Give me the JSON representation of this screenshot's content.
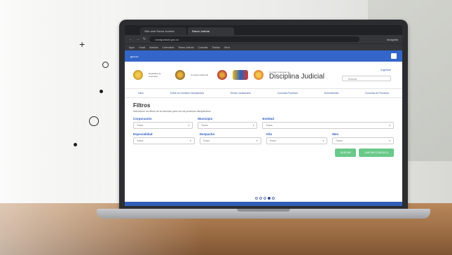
{
  "browser": {
    "tabs": [
      {
        "label": "Sitio web Rama Judicial"
      },
      {
        "label": "Rama Judicial"
      }
    ],
    "address": "ramajudicial.gov.co",
    "incognito": "Incógnito",
    "bookmarks": [
      "Apps",
      "Gmail",
      "Noticias",
      "Calendario",
      "Rama Judicial",
      "Consulta",
      "Tutelas",
      "Otros"
    ]
  },
  "site": {
    "gov_logo": "gov.co",
    "logo_texts": [
      "República de Colombia",
      "Comisión Nacional",
      "Rama Judicial"
    ],
    "brand_title": "Disciplina Judicial",
    "brand_small": "Comisión Nacional de",
    "login": "Ingresar",
    "search_placeholder": "Buscar"
  },
  "nav": [
    "Inicio",
    "Sobre la Comisión Disciplinaria",
    "Temas Jurisdicción",
    "Consulta Procesos",
    "Normatividad",
    "Consulta de Procesos"
  ],
  "filters": {
    "title": "Filtros",
    "description": "Seleccione los filtros de su elección para ver los procesos disciplinarios",
    "row1": [
      {
        "label": "Corporación",
        "value": "Todos"
      },
      {
        "label": "Municipio",
        "value": "Todos"
      },
      {
        "label": "Entidad",
        "value": "Todos"
      }
    ],
    "row2": [
      {
        "label": "Especialidad",
        "value": "Todos"
      },
      {
        "label": "Despacho",
        "value": "Todos"
      },
      {
        "label": "Año",
        "value": "Todos"
      },
      {
        "label": "Mes",
        "value": "Todos"
      }
    ],
    "buttons": {
      "search": "BUSCAR",
      "clear": "LIMPIAR CONSULTA"
    }
  },
  "colors": {
    "accent": "#2a5cbf",
    "button": "#69c98a",
    "govbar": "#3466c9"
  }
}
